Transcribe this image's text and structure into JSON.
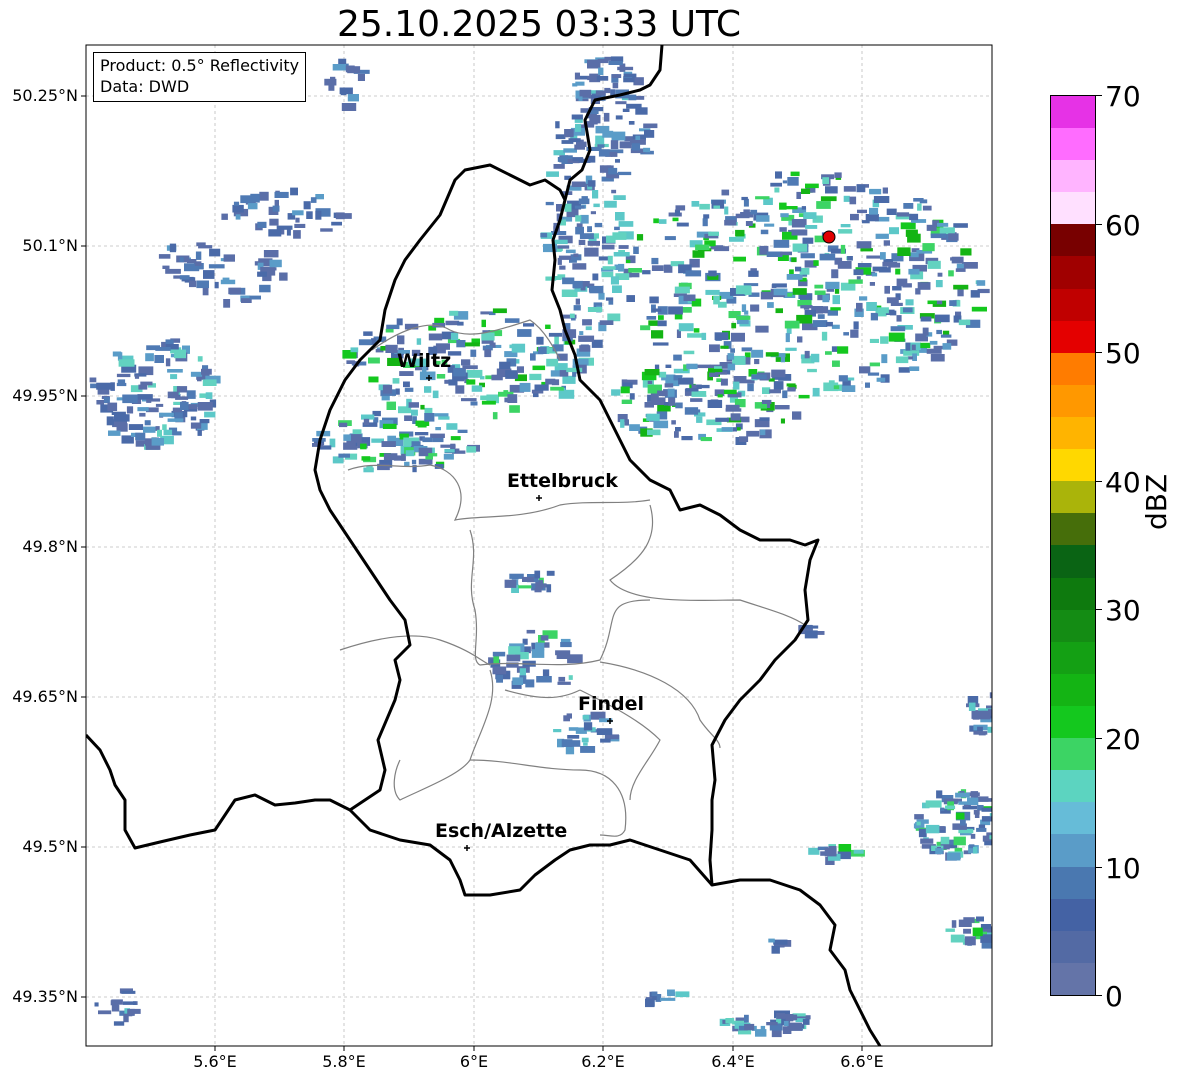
{
  "title": "25.10.2025 03:33 UTC",
  "info": {
    "product": "Product: 0.5° Reflectivity",
    "data": "Data: DWD"
  },
  "lat_ticks": [
    "50.25°N",
    "50.1°N",
    "49.95°N",
    "49.8°N",
    "49.65°N",
    "49.5°N",
    "49.35°N"
  ],
  "lon_ticks": [
    "5.6°E",
    "5.8°E",
    "6°E",
    "6.2°E",
    "6.4°E",
    "6.6°E"
  ],
  "cities": [
    {
      "name": "Wiltz"
    },
    {
      "name": "Ettelbruck"
    },
    {
      "name": "Findel"
    },
    {
      "name": "Esch/Alzette"
    }
  ],
  "radar_site": {
    "name": "radar-site",
    "color": "#e00000"
  },
  "colorbar": {
    "label": "dBZ",
    "ticks": [
      "0",
      "10",
      "20",
      "30",
      "40",
      "50",
      "60",
      "70"
    ],
    "colors": [
      "#6474a8",
      "#536aa4",
      "#4462a4",
      "#4a78b0",
      "#5a9cc8",
      "#66bcd8",
      "#5cd4c0",
      "#3cd464",
      "#14c81e",
      "#14b414",
      "#14a014",
      "#148c14",
      "#0e7a0e",
      "#0a6414",
      "#466e0a",
      "#aab40a",
      "#ffd800",
      "#ffb400",
      "#ff9800",
      "#ff7c00",
      "#e40000",
      "#c00000",
      "#a00000",
      "#780000",
      "#ffe0ff",
      "#ffb4ff",
      "#ff6cff",
      "#e632e6"
    ]
  },
  "colors": {
    "echo_low": "#5a6ea8",
    "echo_mid": "#5cc8c8",
    "echo_high": "#14c81e",
    "border": "#000000",
    "district": "#808080"
  }
}
